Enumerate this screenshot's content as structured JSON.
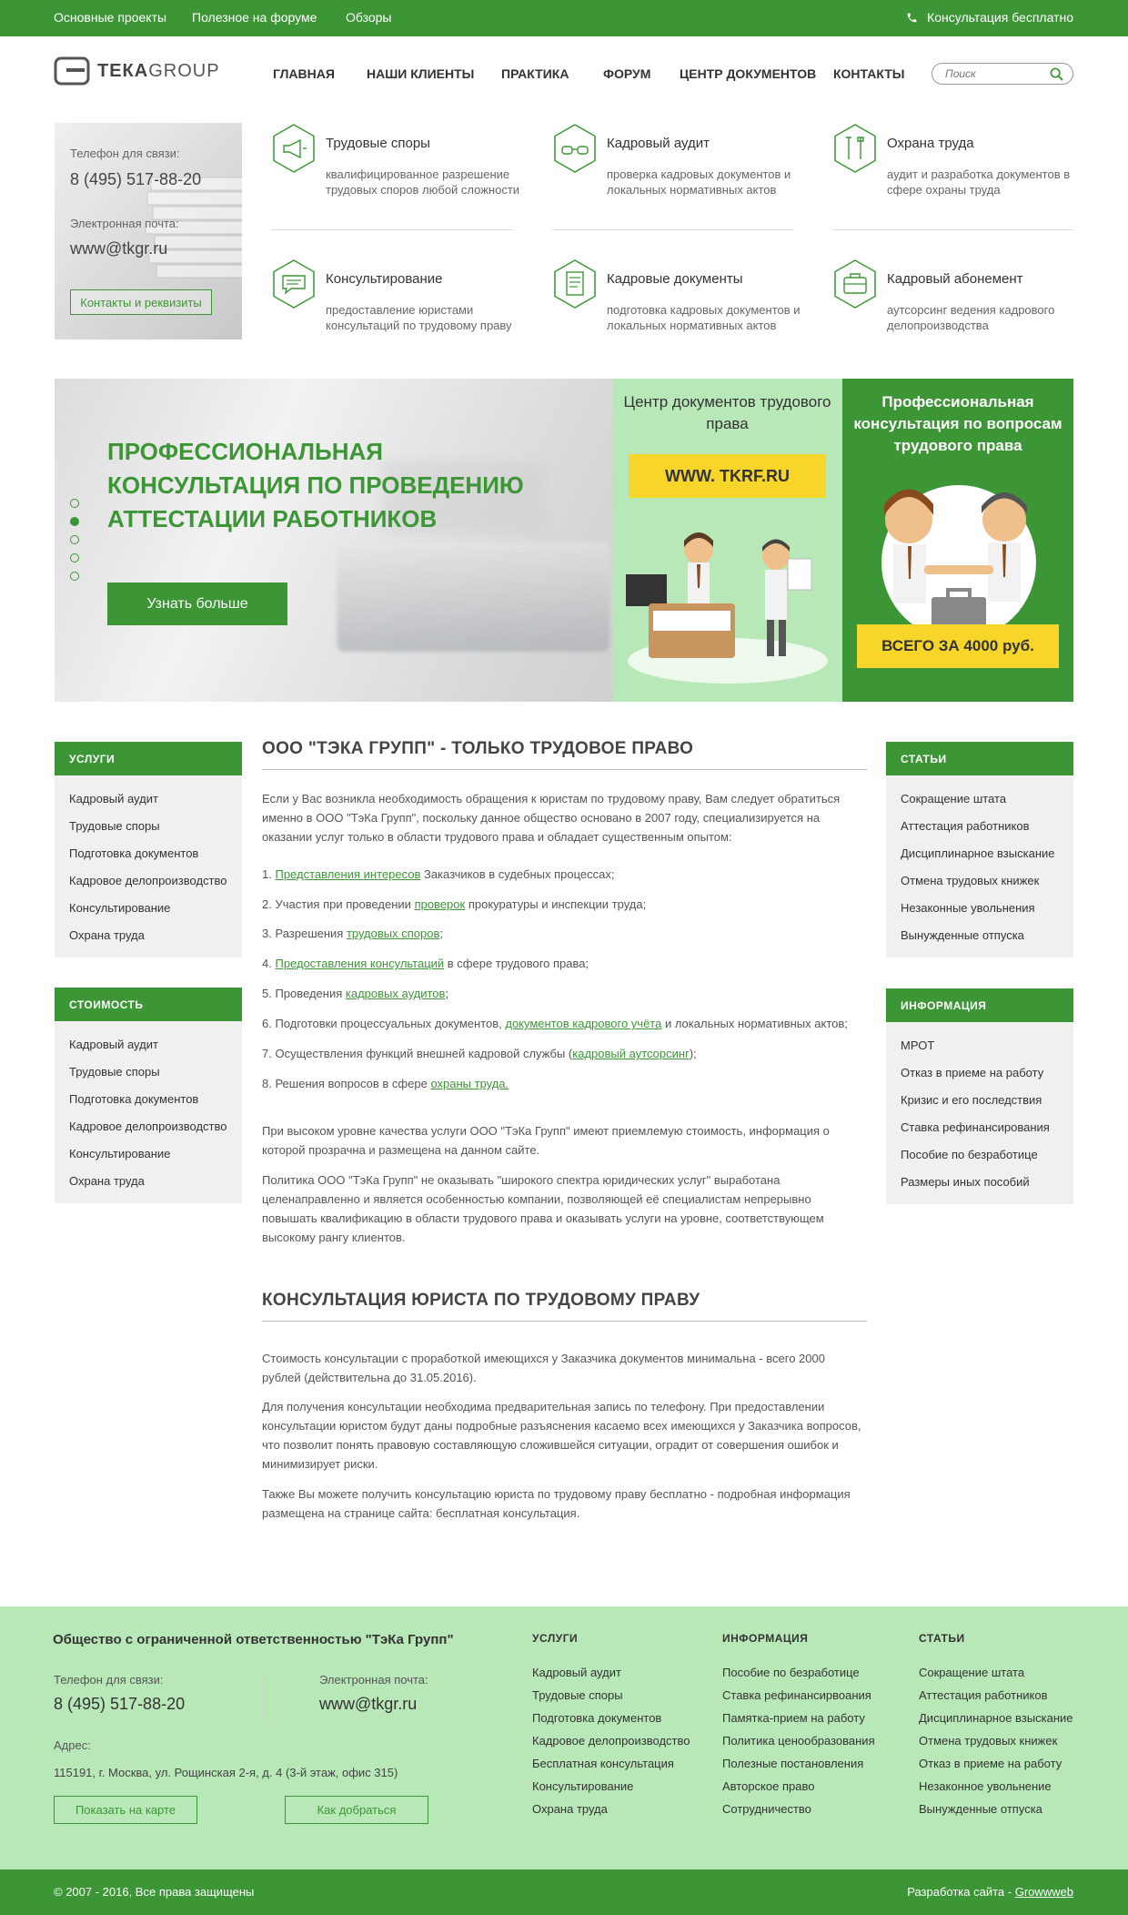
{
  "topbar": {
    "links": [
      "Основные проекты",
      "Полезное на форуме",
      "Обзоры"
    ],
    "consult": "Консультация бесплатно"
  },
  "logo": {
    "part1": "ТЕКА",
    "part2": "GROUP"
  },
  "nav": [
    "ГЛАВНАЯ",
    "НАШИ КЛИЕНТЫ",
    "ПРАКТИКА",
    "ФОРУМ",
    "ЦЕНТР ДОКУМЕНТОВ",
    "КОНТАКТЫ"
  ],
  "search": {
    "placeholder": "Поиск"
  },
  "contact": {
    "phone_label": "Телефон для связи:",
    "phone": "8 (495) 517-88-20",
    "email_label": "Электронная почта:",
    "email": "www@tkgr.ru",
    "button": "Контакты и реквизиты"
  },
  "services": [
    {
      "title": "Трудовые споры",
      "desc": "квалифицированное разрешение трудовых споров любой сложности",
      "icon": "megaphone-icon"
    },
    {
      "title": "Кадровый аудит",
      "desc": "проверка кадровых документов и локальных нормативных актов",
      "icon": "glasses-icon"
    },
    {
      "title": "Охрана труда",
      "desc": "аудит и разработка документов в сфере охраны труда",
      "icon": "tools-icon"
    },
    {
      "title": "Консультирование",
      "desc": "предоставление юристами консультаций по трудовому праву",
      "icon": "chat-icon"
    },
    {
      "title": "Кадровые документы",
      "desc": "подготовка кадровых документов и локальных нормативных актов",
      "icon": "document-icon"
    },
    {
      "title": "Кадровый абонемент",
      "desc": "аутсорсинг ведения кадрового делопроизводства",
      "icon": "briefcase-icon"
    }
  ],
  "banner": {
    "title": "ПРОФЕССИОНАЛЬНАЯ КОНСУЛЬТАЦИЯ ПО ПРОВЕДЕНИЮ АТТЕСТАЦИИ РАБОТНИКОВ",
    "button": "Узнать больше",
    "active_slide": 2,
    "slides": 5
  },
  "promo1": {
    "title": "Центр документов трудового права",
    "ribbon": "WWW. TKRF.RU"
  },
  "promo2": {
    "title": "Профессиональная консультация по вопросам трудового права",
    "ribbon": "ВСЕГО ЗА 4000 руб."
  },
  "left_menus": [
    {
      "title": "УСЛУГИ",
      "items": [
        "Кадровый аудит",
        "Трудовые споры",
        "Подготовка документов",
        "Кадровое делопроизводство",
        "Консультирование",
        "Охрана труда"
      ]
    },
    {
      "title": "СТОИМОСТЬ",
      "items": [
        "Кадровый аудит",
        "Трудовые споры",
        "Подготовка документов",
        "Кадровое делопроизводство",
        "Консультирование",
        "Охрана труда"
      ]
    }
  ],
  "right_menus": [
    {
      "title": "СТАТЬИ",
      "items": [
        "Сокращение штата",
        "Аттестация работников",
        "Дисциплинарное взыскание",
        "Отмена трудовых книжек",
        "Незаконные увольнения",
        "Вынужденные отпуска"
      ]
    },
    {
      "title": "ИНФОРМАЦИЯ",
      "items": [
        "МРОТ",
        "Отказ в приеме на работу",
        "Кризис и его последствия",
        "Ставка рефинансирования",
        "Пособие по безработице",
        "Размеры иных пособий"
      ]
    }
  ],
  "article1": {
    "heading": "ООО \"ТЭКА ГРУПП\" - ТОЛЬКО ТРУДОВОЕ ПРАВО",
    "intro": "Если у Вас возникла необходимость обращения к юристам по трудовому праву, Вам следует обратиться именно в ООО \"ТэКа Групп\", поскольку данное общество основано в 2007 году, специализируется на оказании услуг только в области трудового права и обладает существенным опытом:",
    "list": [
      {
        "pre": "1. ",
        "link": "Представления интересов",
        "post": " Заказчиков в судебных процессах;"
      },
      {
        "pre": "2. Участия при проведении ",
        "link": "проверок",
        "post": " прокуратуры и инспекции труда;"
      },
      {
        "pre": "3. Разрешения ",
        "link": "трудовых споров",
        "post": ";"
      },
      {
        "pre": "4. ",
        "link": "Предоставления консультаций",
        "post": " в сфере трудового права;"
      },
      {
        "pre": "5. Проведения ",
        "link": "кадровых аудитов",
        "post": ";"
      },
      {
        "pre": "6. Подготовки процессуальных документов, ",
        "link": "документов кадрового учёта",
        "post": " и локальных нормативных актов;"
      },
      {
        "pre": "7. Осуществления функций внешней кадровой службы (",
        "link": "кадровый аутсорсинг",
        "post": ");"
      },
      {
        "pre": "8. Решения вопросов в сфере ",
        "link": "охраны труда.",
        "post": ""
      }
    ],
    "p2": "При высоком уровне качества услуги ООО \"ТэКа Групп\" имеют приемлемую стоимость, информация о которой прозрачна и размещена на данном сайте.",
    "p3": "Политика ООО \"ТэКа Групп\" не оказывать \"широкого спектра юридических услуг\" выработана целенаправленно и является особенностью компании, позволяющей её специалистам непрерывно повышать квалификацию в области трудового права и оказывать услуги на уровне, соответствующем высокому рангу клиентов."
  },
  "article2": {
    "heading": "КОНСУЛЬТАЦИЯ ЮРИСТА ПО ТРУДОВОМУ ПРАВУ",
    "p1": "Стоимость консультации с проработкой имеющихся у Заказчика документов минимальна - всего 2000 рублей (действительна до 31.05.2016).",
    "p2": "Для получения консультации необходима предварительная запись по телефону. При предоставлении консультации юристом будут даны подробные разъяснения касаемо всех имеющихся у Заказчика вопросов, что позволит понять правовую составляющую сложившейся ситуации, оградит от совершения ошибок и минимизирует риски.",
    "p3": "Также Вы можете получить консультацию юриста по трудовому праву бесплатно - подробная информация размещена на странице сайта: бесплатная консультация."
  },
  "footer": {
    "company": "Общество с ограниченной ответственностью \"ТэКа Групп\"",
    "phone_label": "Телефон для связи:",
    "phone": "8 (495) 517-88-20",
    "email_label": "Электронная почта:",
    "email": "www@tkgr.ru",
    "address_label": "Адрес:",
    "address": "115191, г. Москва, ул. Рощинская 2-я, д. 4 (3-й этаж, офис 315)",
    "btn_map": "Показать на карте",
    "btn_route": "Как добраться",
    "columns": [
      {
        "title": "УСЛУГИ",
        "items": [
          "Кадровый аудит",
          "Трудовые споры",
          "Подготовка документов",
          "Кадровое делопроизводство",
          "Бесплатная консультация",
          "Консультирование",
          "Охрана труда"
        ]
      },
      {
        "title": "ИНФОРМАЦИЯ",
        "items": [
          "Пособие по безработице",
          "Ставка рефинансирвоания",
          "Памятка-прием на работу",
          "Политика ценообразования",
          "Полезные постановления",
          "Авторское право",
          "Сотрудничество"
        ]
      },
      {
        "title": "СТАТЬИ",
        "items": [
          "Сокращение штата",
          "Аттестация работников",
          "Дисциплинарное взыскание",
          "Отмена трудовых книжек",
          "Отказ в приеме на работу",
          "Незаконное увольнение",
          "Вынужденные отпуска"
        ]
      }
    ]
  },
  "bottom": {
    "copyright": "© 2007 - 2016, Все права защищены",
    "dev_label": "Разработка сайта - ",
    "dev_name": "Growwweb"
  },
  "colors": {
    "brand_green": "#3c9636",
    "light_green": "#b9e8b8",
    "ribbon_yellow": "#f7d529"
  }
}
